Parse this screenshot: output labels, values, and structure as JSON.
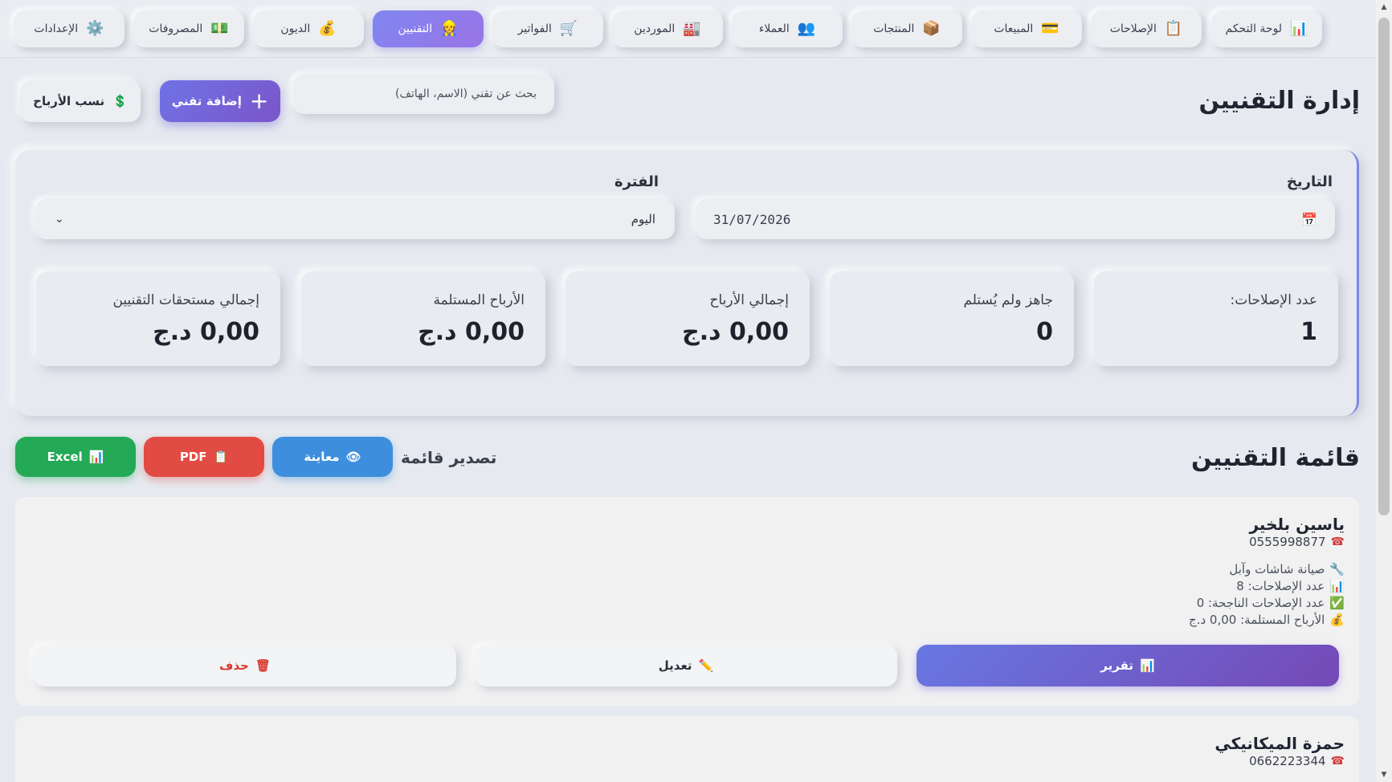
{
  "nav": {
    "items": [
      {
        "label": "لوحة التحكم",
        "icon": "📊"
      },
      {
        "label": "الإصلاحات",
        "icon": "📋"
      },
      {
        "label": "المبيعات",
        "icon": "💳"
      },
      {
        "label": "المنتجات",
        "icon": "📦"
      },
      {
        "label": "العملاء",
        "icon": "👥"
      },
      {
        "label": "الموردين",
        "icon": "🏭"
      },
      {
        "label": "الفواتير",
        "icon": "🛒"
      },
      {
        "label": "التقنيين",
        "icon": "👷"
      },
      {
        "label": "الديون",
        "icon": "💰"
      },
      {
        "label": "المصروفات",
        "icon": "💵"
      },
      {
        "label": "الإعدادات",
        "icon": "⚙️"
      }
    ],
    "active_index": 7
  },
  "header": {
    "title": "إدارة التقنيين",
    "search_placeholder": "بحث عن تقني (الاسم، الهاتف)",
    "add_label": "إضافة تقني",
    "add_icon": "+",
    "profit_label": "نسب الأرباح",
    "profit_icon": "💲"
  },
  "filters": {
    "date_label": "التاريخ",
    "date_value": "31/07/2026",
    "date_icon": "📅",
    "period_label": "الفترة",
    "period_value": "اليوم",
    "period_chevron": "⌄"
  },
  "stats": [
    {
      "label": "عدد الإصلاحات:",
      "value": "1"
    },
    {
      "label": "جاهز ولم يُستلم",
      "value": "0"
    },
    {
      "label": "إجمالي الأرباح",
      "value": "0,00 د.ج"
    },
    {
      "label": "الأرباح المستلمة",
      "value": "0,00 د.ج"
    },
    {
      "label": "إجمالي مستحقات التقنيين",
      "value": "0,00 د.ج"
    }
  ],
  "list": {
    "title": "قائمة التقنيين",
    "export_label": "تصدير قائمة",
    "preview_label": "معاينة",
    "preview_icon": "👁",
    "pdf_label": "PDF",
    "pdf_icon": "📋",
    "excel_label": "Excel",
    "excel_icon": "📊"
  },
  "technicians": [
    {
      "name": "ياسين بلخير",
      "phone": "0555998877",
      "phone_icon": "☎",
      "details": [
        {
          "icon": "🔧",
          "text": "صيانة شاشات وآبل"
        },
        {
          "icon": "📊",
          "text": "عدد الإصلاحات: 8"
        },
        {
          "icon": "✅",
          "text": "عدد الإصلاحات الناجحة: 0"
        },
        {
          "icon": "💰",
          "text": "الأرباح المستلمة: 0,00 د.ج"
        }
      ],
      "report_label": "تقرير",
      "report_icon": "📊",
      "edit_label": "تعديل",
      "edit_icon": "✏️",
      "delete_label": "حذف",
      "delete_icon": "🗑"
    },
    {
      "name": "حمزة الميكانيكي",
      "phone": "0662223344",
      "phone_icon": "☎"
    }
  ],
  "scrollbar": {
    "up": "▲",
    "down": "▼"
  }
}
